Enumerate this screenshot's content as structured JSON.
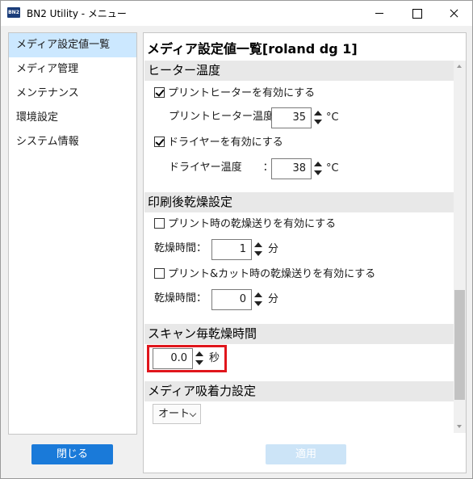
{
  "window": {
    "icon_text": "BN2",
    "title": "BN2 Utility - メニュー"
  },
  "sidebar": {
    "items": [
      {
        "label": "メディア設定値一覧",
        "selected": true
      },
      {
        "label": "メディア管理",
        "selected": false
      },
      {
        "label": "メンテナンス",
        "selected": false
      },
      {
        "label": "環境設定",
        "selected": false
      },
      {
        "label": "システム情報",
        "selected": false
      }
    ],
    "close_label": "閉じる"
  },
  "main": {
    "title": "メディア設定値一覧[roland dg 1]",
    "heater": {
      "header": "ヒーター温度",
      "print_heater_enable": "プリントヒーターを有効にする",
      "print_heater_enabled": true,
      "print_heater_temp_label": "プリントヒーター温度：",
      "print_heater_temp": "35",
      "dryer_enable": "ドライヤーを有効にする",
      "dryer_enabled": true,
      "dryer_temp_label": "ドライヤー温度　　：",
      "dryer_temp": "38",
      "unit": "°C"
    },
    "post_dry": {
      "header": "印刷後乾燥設定",
      "print_feed_enable": "プリント時の乾燥送りを有効にする",
      "print_feed_enabled": false,
      "dry_time_label": "乾燥時間：",
      "dry_time_1": "1",
      "cut_feed_enable": "プリント&カット時の乾燥送りを有効にする",
      "cut_feed_enabled": false,
      "dry_time_2": "0",
      "minute_unit": "分"
    },
    "scan_dry": {
      "header": "スキャン毎乾燥時間",
      "value": "0.0",
      "unit": "秒"
    },
    "suction": {
      "header": "メディア吸着力設定",
      "value": "オート"
    },
    "apply_label": "適用"
  },
  "colors": {
    "selection": "#cce8ff",
    "primary_button": "#1a7ad9",
    "disabled_button": "#cce4f7",
    "highlight": "#e0161c",
    "section_header": "#e8e8e8"
  }
}
